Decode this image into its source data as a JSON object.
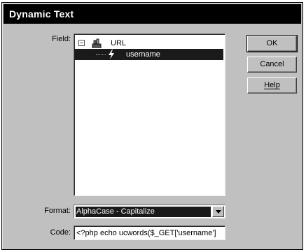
{
  "dialog": {
    "title": "Dynamic Text"
  },
  "field": {
    "label": "Field:",
    "tree": {
      "root": {
        "expander": "−",
        "icon": "data-source-icon",
        "label": "URL"
      },
      "children": [
        {
          "icon": "lightning-bolt-icon",
          "label": "username",
          "selected": true
        }
      ]
    }
  },
  "buttons": {
    "ok": "OK",
    "cancel": "Cancel",
    "help": "Help"
  },
  "format": {
    "label": "Format:",
    "selected": "AlphaCase - Capitalize"
  },
  "code": {
    "label": "Code:",
    "value": "<?php echo ucwords($_GET['username']"
  },
  "colors": {
    "dialog_bg": "#c0c0c0",
    "titlebar_bg": "#000000",
    "selection_bg": "#1a1a1a"
  }
}
